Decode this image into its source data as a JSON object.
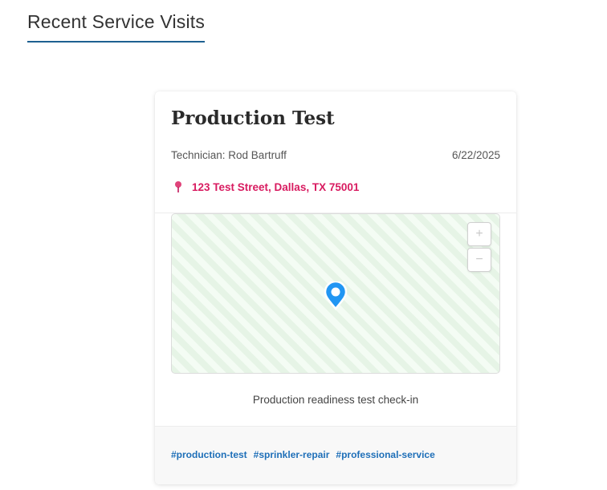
{
  "page": {
    "title": "Recent Service Visits"
  },
  "visit": {
    "title": "Production Test",
    "technician": "Technician: Rod Bartruff",
    "date": "6/22/2025",
    "address": "123 Test Street, Dallas, TX 75001",
    "note": "Production readiness test check-in",
    "tags": [
      "#production-test",
      "#sprinkler-repair",
      "#professional-service"
    ]
  },
  "map": {
    "zoom_in": "+",
    "zoom_out": "−",
    "marker_icon": "map-pin-icon"
  },
  "colors": {
    "accent": "#1e6091",
    "address": "#d81b60",
    "marker": "#2196f3",
    "tag": "#1e6fb8"
  }
}
